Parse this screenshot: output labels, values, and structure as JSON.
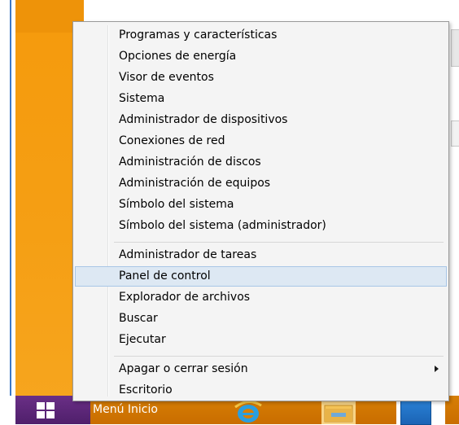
{
  "menu": {
    "group1": [
      {
        "label": "Programas y características"
      },
      {
        "label": "Opciones de energía"
      },
      {
        "label": "Visor de eventos"
      },
      {
        "label": "Sistema"
      },
      {
        "label": "Administrador de dispositivos"
      },
      {
        "label": "Conexiones de red"
      },
      {
        "label": "Administración de discos"
      },
      {
        "label": "Administración de equipos"
      },
      {
        "label": "Símbolo del sistema"
      },
      {
        "label": "Símbolo del sistema (administrador)"
      }
    ],
    "group2": [
      {
        "label": "Administrador de tareas"
      },
      {
        "label": "Panel de control",
        "highlighted": true
      },
      {
        "label": "Explorador de archivos"
      },
      {
        "label": "Buscar"
      },
      {
        "label": "Ejecutar"
      }
    ],
    "group3": [
      {
        "label": "Apagar o cerrar sesión",
        "has_submenu": true
      },
      {
        "label": "Escritorio"
      }
    ]
  },
  "taskbar": {
    "start_label": "Menú Inicio",
    "icons": [
      "windows-logo-icon",
      "internet-explorer-icon",
      "file-explorer-folder-icon",
      "tile-app-icon"
    ]
  },
  "colors": {
    "desktop_orange": "#f59a0c",
    "taskbar_orange": "#c96d00",
    "start_purple": "#4f1f6b",
    "menu_background": "#f4f4f4",
    "highlight_background": "#dde8f3",
    "highlight_border": "#a8c6e6"
  }
}
